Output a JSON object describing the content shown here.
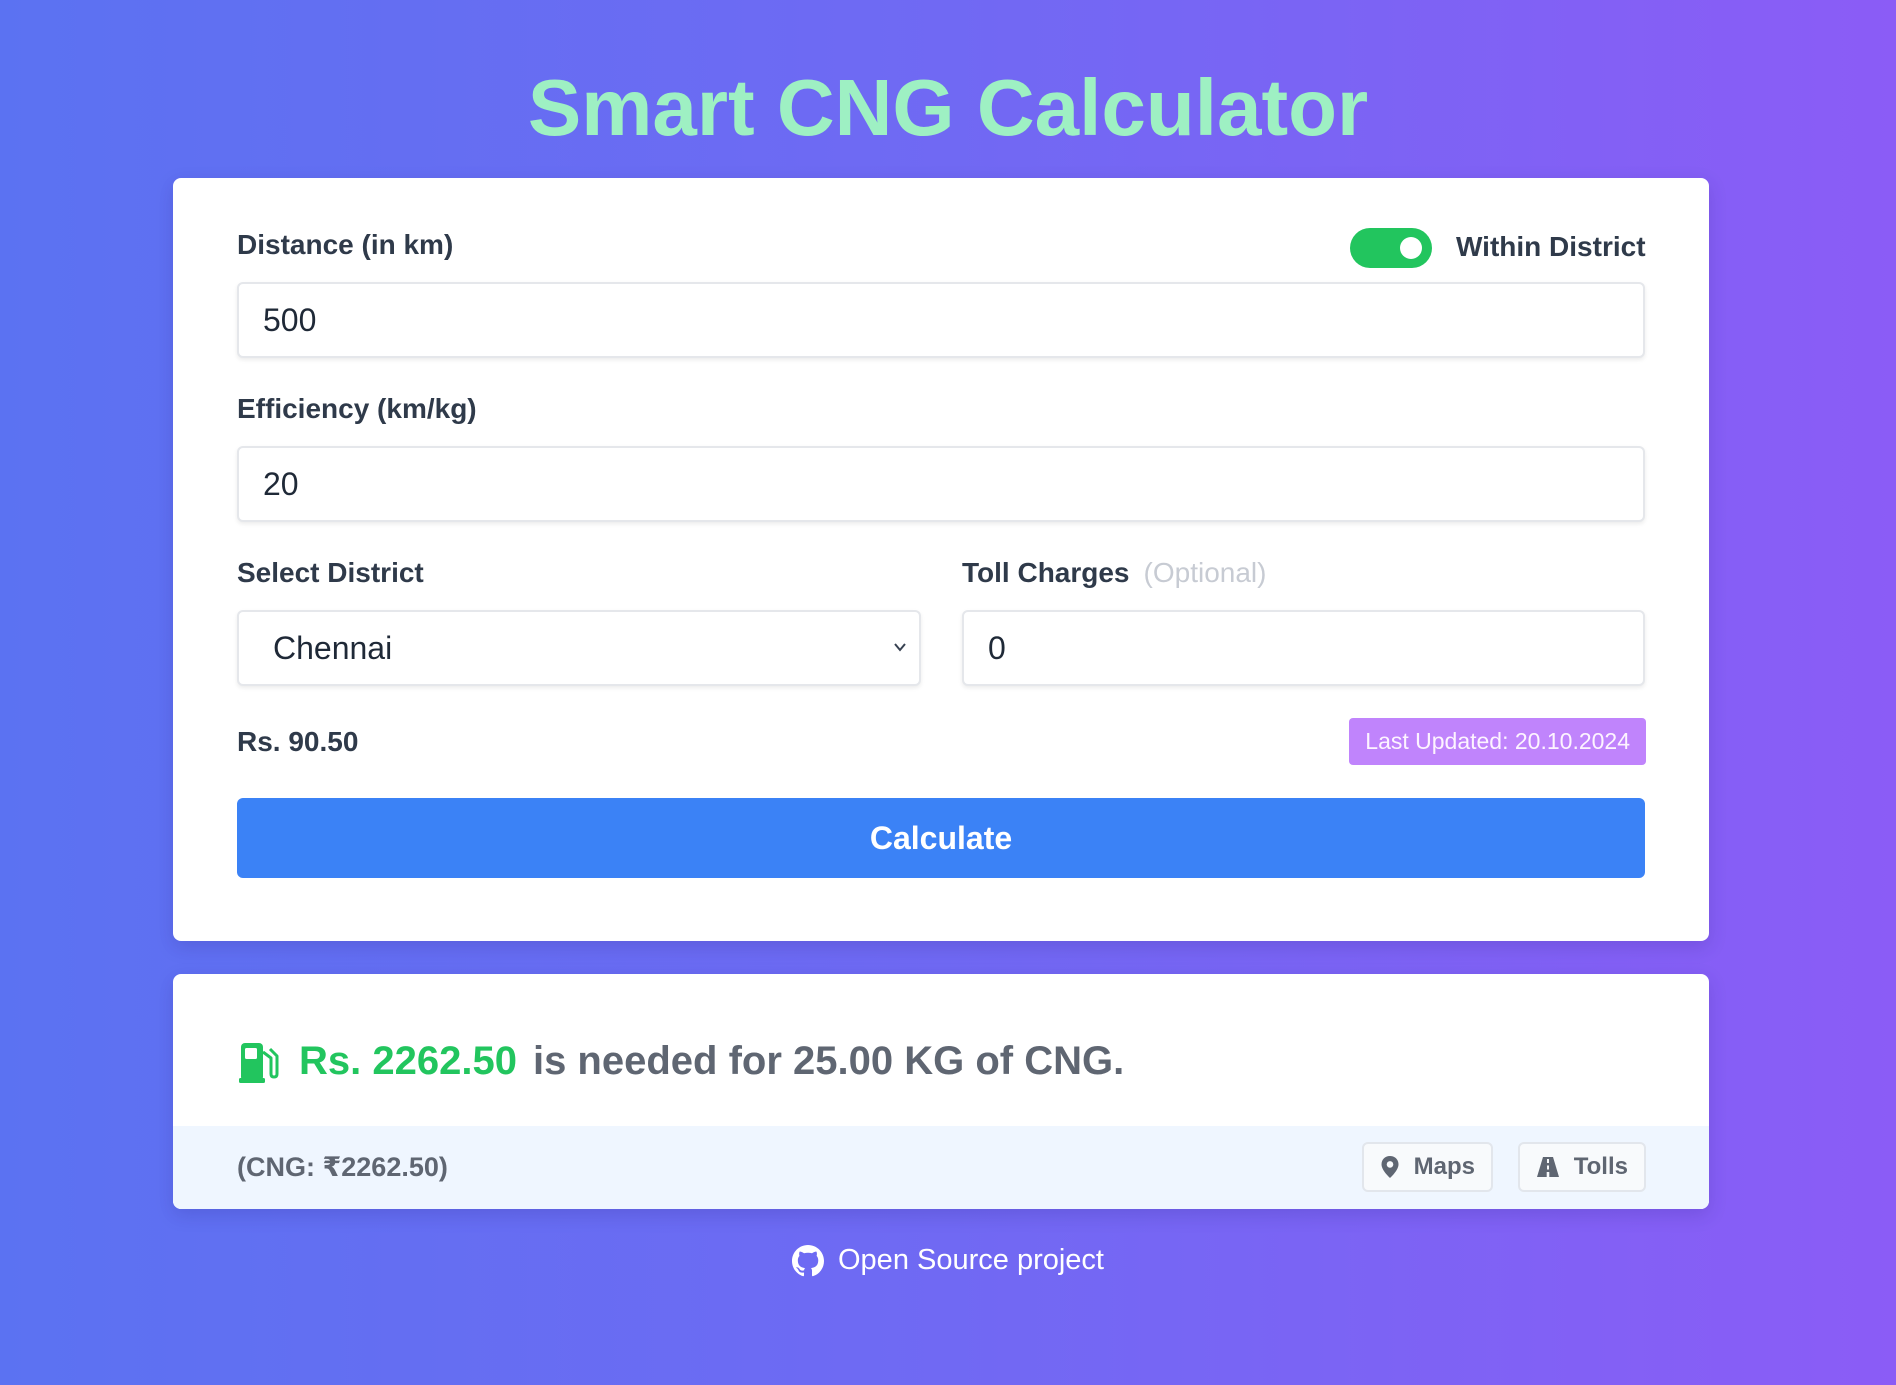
{
  "header": {
    "title": "Smart CNG Calculator"
  },
  "form": {
    "distance_label": "Distance (in km)",
    "distance_value": "500",
    "within_district_label": "Within District",
    "within_district_on": true,
    "efficiency_label": "Efficiency (km/kg)",
    "efficiency_value": "20",
    "district_label": "Select District",
    "district_value": "Chennai",
    "toll_label": "Toll Charges",
    "toll_optional": "(Optional)",
    "toll_value": "0",
    "price": "Rs. 90.50",
    "last_updated": "Last Updated: 20.10.2024",
    "calculate_label": "Calculate"
  },
  "result": {
    "amount": "Rs. 2262.50",
    "message": "is needed for 25.00 KG of CNG.",
    "breakdown": "(CNG: ₹2262.50)",
    "maps_label": "Maps",
    "tolls_label": "Tolls"
  },
  "footer": {
    "link_label": "Open Source project"
  },
  "colors": {
    "accent": "#3b82f6",
    "success": "#22c55e",
    "title": "#9ef0c3",
    "badge": "#c084fc"
  },
  "icons": [
    "fuel-pump-icon",
    "map-pin-icon",
    "road-icon",
    "github-icon",
    "chevron-down-icon"
  ]
}
